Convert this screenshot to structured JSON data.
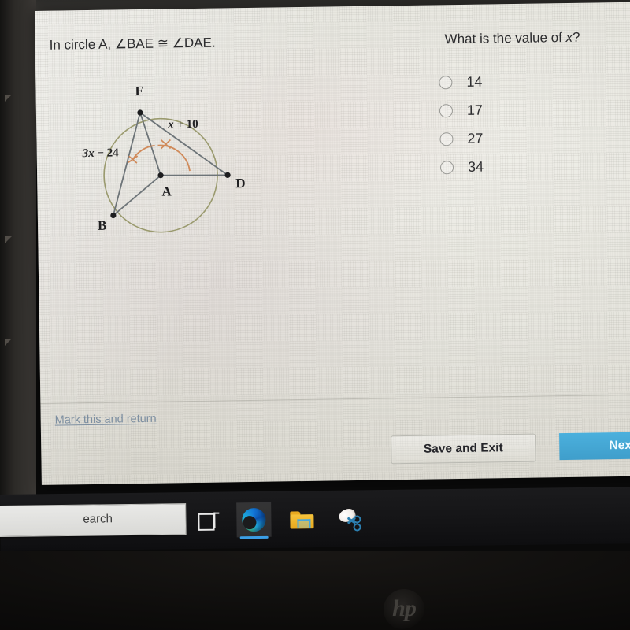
{
  "question": {
    "stem_prefix": "In circle A, ",
    "stem_rest": "∠BAE ≅ ∠DAE.",
    "prompt_prefix": "What is the value of ",
    "prompt_var": "x",
    "prompt_suffix": "?"
  },
  "options": [
    {
      "label": "14",
      "selected": false
    },
    {
      "label": "17",
      "selected": false
    },
    {
      "label": "27",
      "selected": false
    },
    {
      "label": "34",
      "selected": false
    }
  ],
  "figure": {
    "center_label": "A",
    "point_e": "E",
    "point_b": "B",
    "point_d": "D",
    "chord_eb_expr_a": "3x",
    "chord_eb_expr_b": " − 24",
    "chord_ed_expr_a": "x",
    "chord_ed_expr_b": " + 10",
    "circle_color": "#9a9a6e",
    "line_color": "#6d7478",
    "tick_color": "#d08a5a"
  },
  "footer": {
    "mark_link": "Mark this and return",
    "save_button": "Save and Exit",
    "next_button": "Next",
    "next_color": "#42a5d2"
  },
  "taskbar": {
    "search_text": "earch",
    "items": [
      {
        "name": "task-view",
        "active": false
      },
      {
        "name": "microsoft-edge",
        "active": true
      },
      {
        "name": "file-explorer",
        "active": false
      },
      {
        "name": "snip-and-sketch",
        "active": false
      }
    ]
  },
  "device": {
    "brand": "hp"
  }
}
